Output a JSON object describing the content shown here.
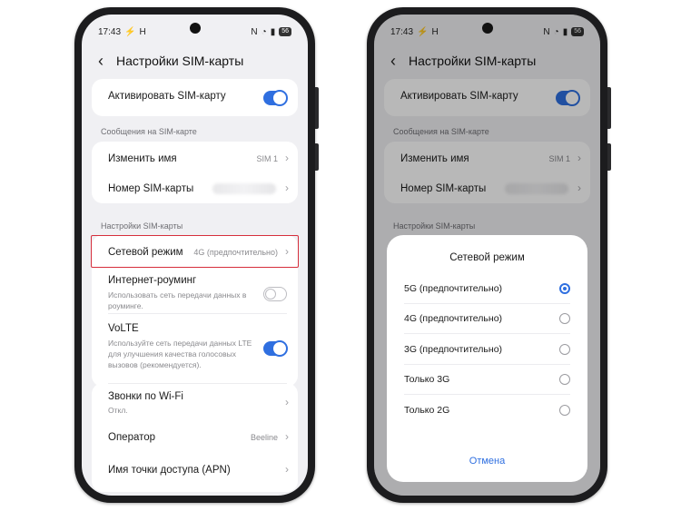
{
  "status": {
    "time": "17:43",
    "left_icon": "H",
    "battery": "56"
  },
  "screen_title": "Настройки SIM-карты",
  "activate": {
    "label": "Активировать SIM-карту",
    "enabled": true
  },
  "section_messages": "Сообщения на SIM-карте",
  "rename": {
    "label": "Изменить имя",
    "value": "SIM 1"
  },
  "number": {
    "label": "Номер SIM-карты"
  },
  "section_settings": "Настройки SIM-карты",
  "network_mode": {
    "label": "Сетевой режим",
    "value": "4G (предпочтительно)"
  },
  "roaming": {
    "label": "Интернет-роуминг",
    "sub1": "Использовать сеть передачи данных в",
    "sub2": "роуминге.",
    "enabled": false
  },
  "volte": {
    "label": "VoLTE",
    "sub1": "Используйте сеть передачи данных LTE",
    "sub2": "для улучшения качества голосовых",
    "sub3": "вызовов (рекомендуется).",
    "enabled": true
  },
  "wifi_calls": {
    "label": "Звонки по Wi-Fi",
    "sub": "Откл."
  },
  "operator": {
    "label": "Оператор",
    "value": "Beeline"
  },
  "apn": {
    "label": "Имя точки доступа (APN)"
  },
  "dialog": {
    "title": "Сетевой режим",
    "options": [
      {
        "label": "5G (предпочтительно)",
        "selected": true
      },
      {
        "label": "4G (предпочтительно)",
        "selected": false
      },
      {
        "label": "3G (предпочтительно)",
        "selected": false
      },
      {
        "label": "Только 3G",
        "selected": false
      },
      {
        "label": "Только 2G",
        "selected": false
      }
    ],
    "cancel": "Отмена"
  },
  "colors": {
    "accent": "#2f6fe0",
    "highlight": "#d62f3c"
  }
}
